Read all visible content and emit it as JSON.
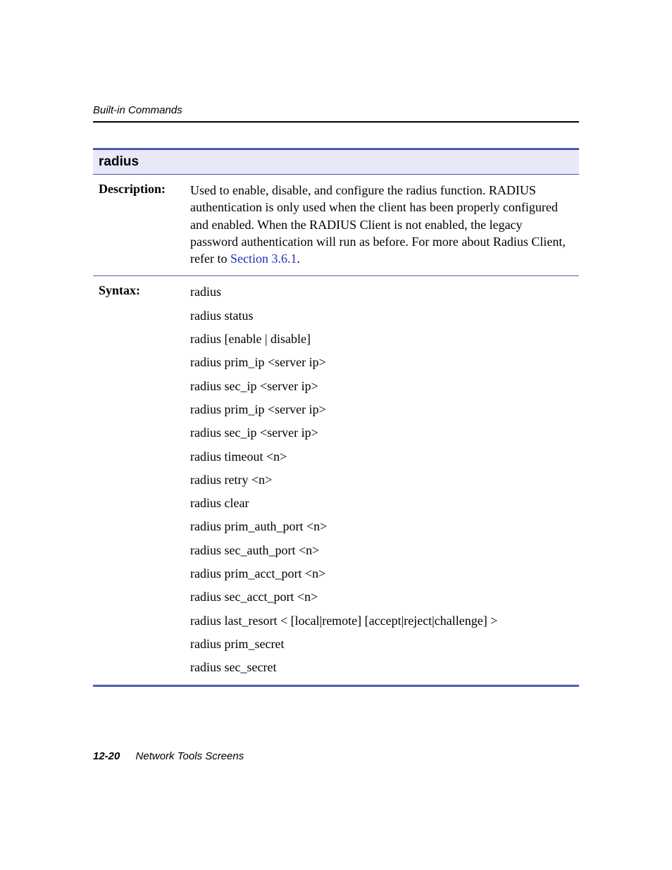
{
  "header": {
    "section": "Built-in Commands"
  },
  "command": {
    "title": "radius",
    "description_label": "Description:",
    "description_text": "Used to enable, disable, and configure the radius function. RADIUS authentication is only used when the client has been properly configured and enabled. When the RADIUS Client is not enabled, the legacy password authentication will run as before. For more about Radius Client, refer to ",
    "description_link": "Section 3.6.1",
    "description_trail": ".",
    "syntax_label": "Syntax:",
    "syntax_lines": [
      "radius",
      "radius status",
      "radius [enable | disable]",
      "radius prim_ip <server ip>",
      "radius sec_ip <server ip>",
      "radius prim_ip <server ip>",
      "radius sec_ip <server ip>",
      "radius timeout <n>",
      "radius retry <n>",
      "radius clear",
      "radius prim_auth_port <n>",
      "radius sec_auth_port <n>",
      "radius prim_acct_port <n>",
      "radius sec_acct_port <n>",
      "radius last_resort < [local|remote] [accept|reject|challenge] >",
      "radius prim_secret",
      "radius sec_secret"
    ]
  },
  "footer": {
    "page_number": "12-20",
    "title": "Network Tools Screens"
  }
}
